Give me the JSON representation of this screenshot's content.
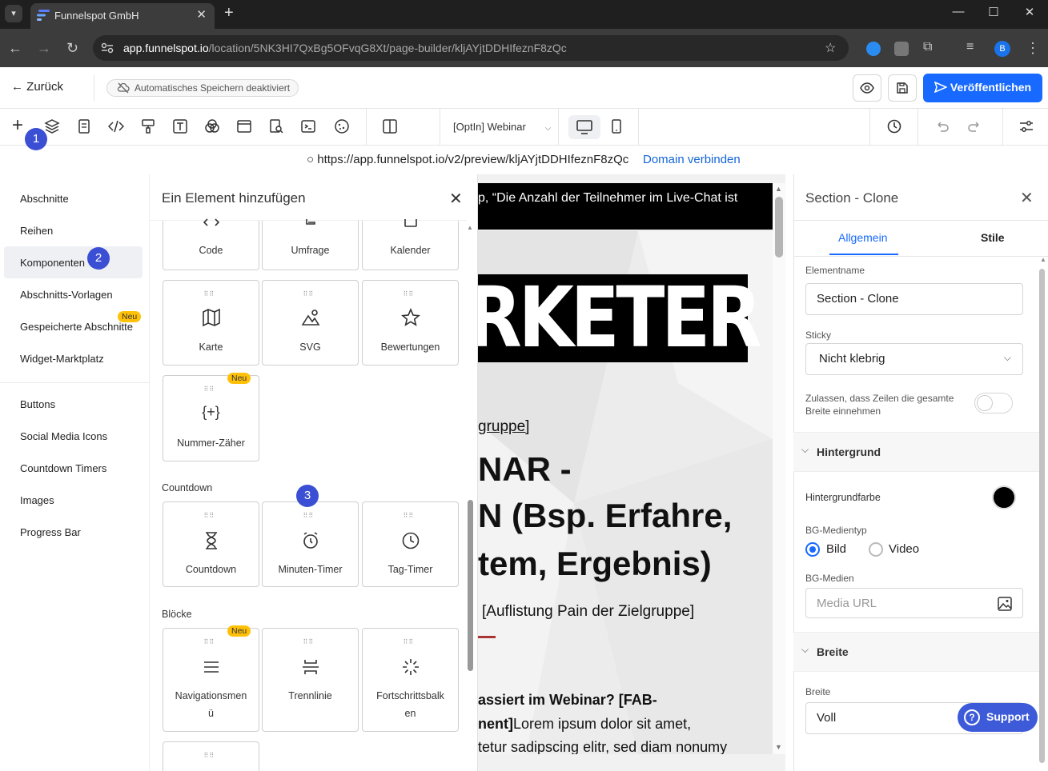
{
  "browser": {
    "tab_title": "Funnelspot GmbH",
    "url_host": "app.funnelspot.io",
    "url_path": "/location/5NK3HI7QxBg5OFvqG8Xt/page-builder/kljAYjtDDHIfeznF8zQc",
    "profile_initial": "B"
  },
  "topbar": {
    "back_label": "Zurück",
    "autosave_label": "Automatisches Speichern deaktiviert",
    "publish_label": "Veröffentlichen"
  },
  "toolbar": {
    "page_select": "[OptIn] Webinar"
  },
  "preview": {
    "url": "https://app.funnelspot.io/v2/preview/kljAYjtDDHIfeznF8zQc",
    "connect_domain": "Domain verbinden"
  },
  "leftnav": {
    "items": [
      "Abschnitte",
      "Reihen",
      "Komponenten",
      "Abschnitts-Vorlagen",
      "Gespeicherte Abschnitte",
      "Widget-Marktplatz"
    ],
    "badge": "Neu",
    "secondary": [
      "Buttons",
      "Social Media Icons",
      "Countdown Timers",
      "Images",
      "Progress Bar"
    ]
  },
  "panel": {
    "title": "Ein Element hinzufügen",
    "row_top": [
      "Code",
      "Umfrage",
      "Kalender"
    ],
    "row2": [
      "Karte",
      "SVG",
      "Bewertungen"
    ],
    "row3": [
      "Nummer-Zäher"
    ],
    "countdown_section": "Countdown",
    "countdown": [
      "Countdown",
      "Minuten-Timer",
      "Tag-Timer"
    ],
    "blocks_section": "Blöcke",
    "blocks_nav_1": "Navigationsmen",
    "blocks_nav_2": "ü",
    "blocks_line": "Trennlinie",
    "blocks_prog_1": "Fortschrittsbalk",
    "blocks_prog_2": "en",
    "badge": "Neu"
  },
  "canvas": {
    "topbar_text": "p, “Die Anzahl der Teilnehmer im Live-Chat ist",
    "banner_text": "RKETER",
    "link_text": "gruppe]",
    "h1_line1": "NAR -",
    "h1_line2": "N (Bsp. Erfahre,",
    "h1_line3": "tem, Ergebnis)",
    "sub_text": "[Auflistung Pain der Zielgruppe]",
    "body1": "assiert im Webinar? [FAB-",
    "body2_bold": "nent]",
    "body2_rest": "Lorem ipsum dolor sit amet,",
    "body3": "tetur sadipscing elitr, sed diam nonumy"
  },
  "right": {
    "title": "Section - Clone",
    "tab_general": "Allgemein",
    "tab_style": "Stile",
    "name_label": "Elementname",
    "name_value": "Section - Clone",
    "sticky_label": "Sticky",
    "sticky_value": "Nicht klebrig",
    "fullwidth_label_1": "Zulassen, dass Zeilen die gesamte",
    "fullwidth_label_2": "Breite einnehmen",
    "bg_group": "Hintergrund",
    "bg_color_label": "Hintergrundfarbe",
    "bg_color": "#000000",
    "media_type_label": "BG-Medientyp",
    "media_opt_image": "Bild",
    "media_opt_video": "Video",
    "media_label": "BG-Medien",
    "media_placeholder": "Media URL",
    "width_group": "Breite",
    "width_label": "Breite",
    "width_value": "Voll",
    "support": "Support"
  },
  "markers": [
    "1",
    "2",
    "3"
  ]
}
